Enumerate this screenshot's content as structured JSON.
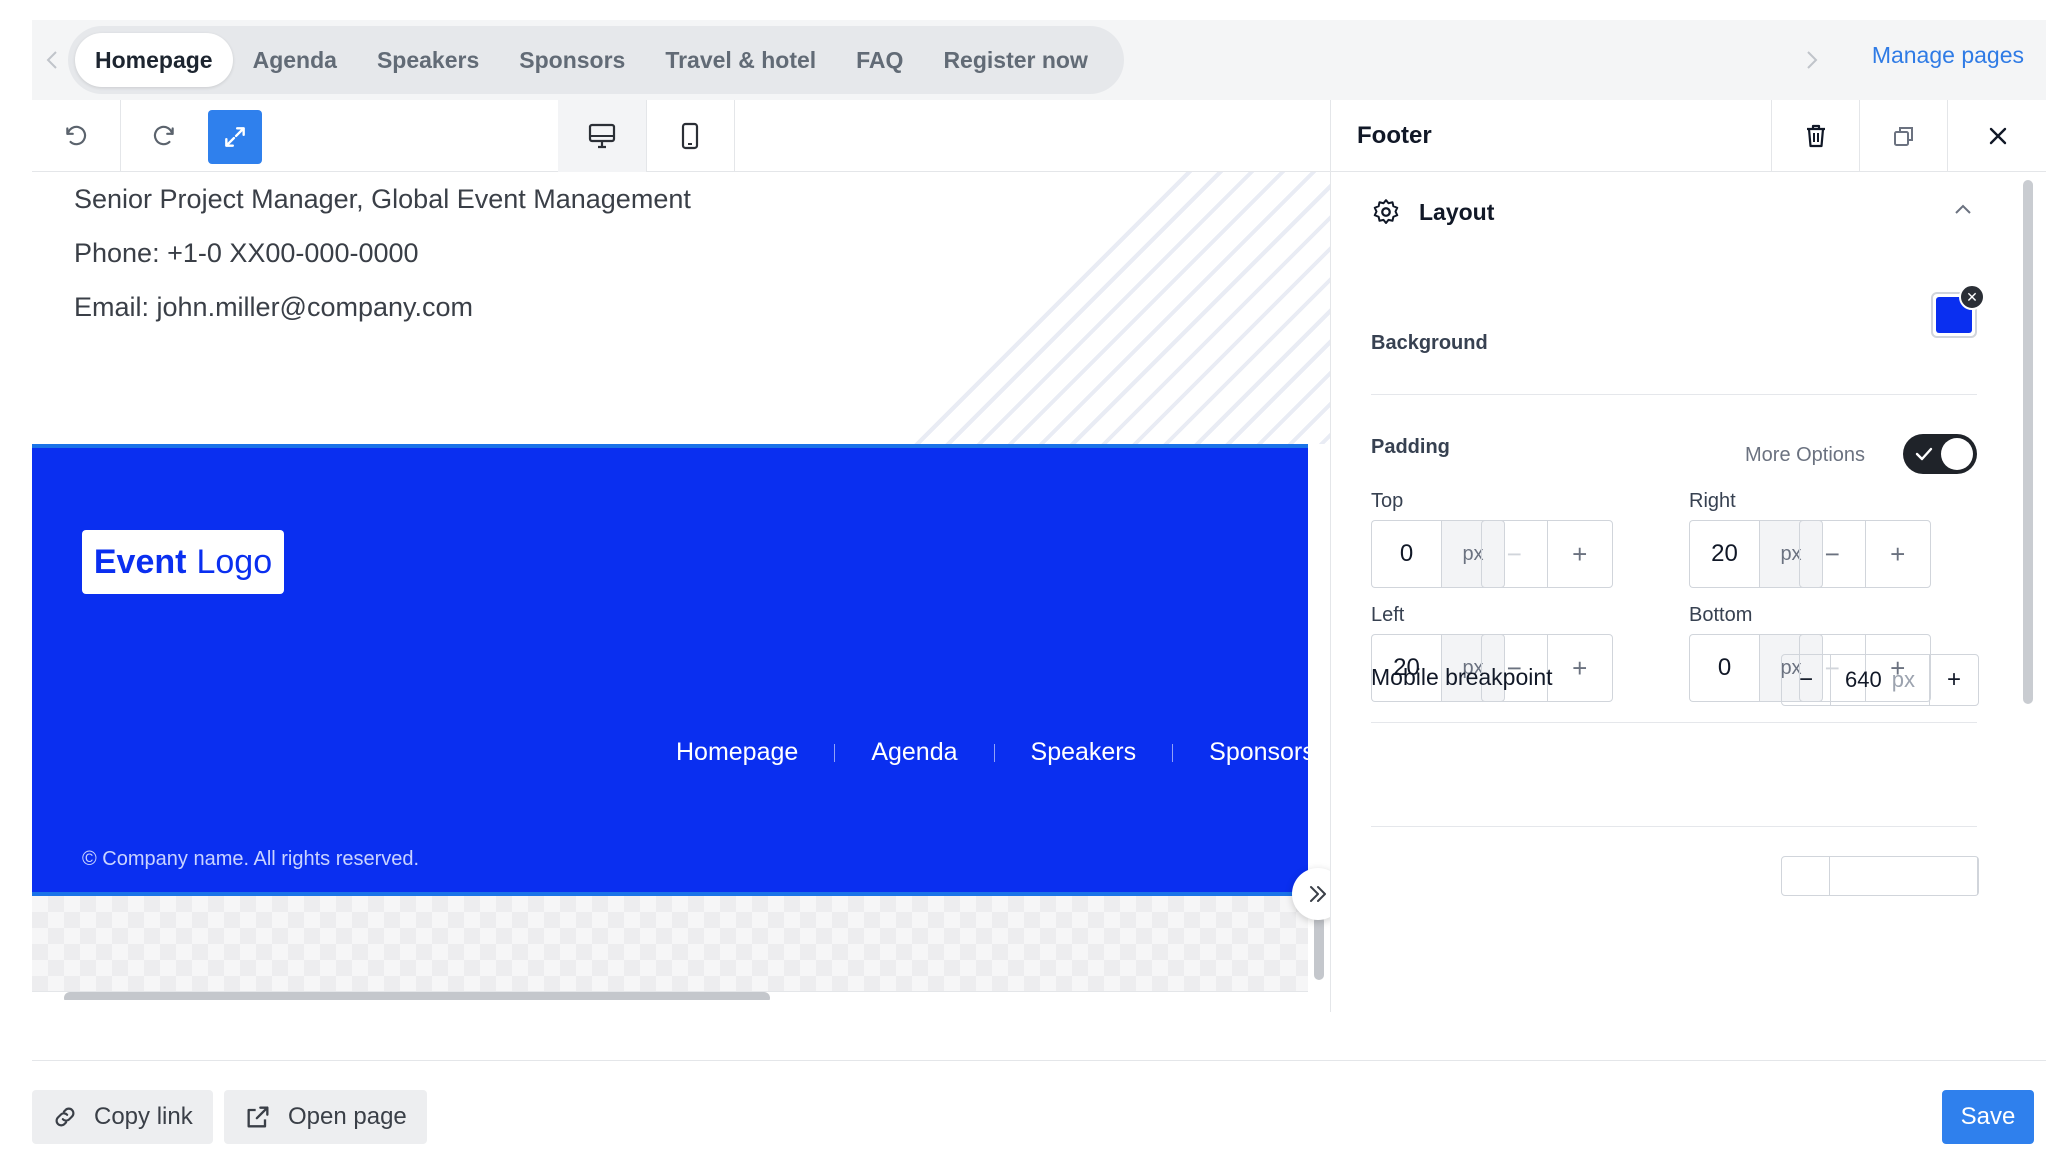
{
  "tabs": {
    "items": [
      {
        "label": "Homepage",
        "active": true
      },
      {
        "label": "Agenda",
        "active": false
      },
      {
        "label": "Speakers",
        "active": false
      },
      {
        "label": "Sponsors",
        "active": false
      },
      {
        "label": "Travel & hotel",
        "active": false
      },
      {
        "label": "FAQ",
        "active": false
      },
      {
        "label": "Register now",
        "active": false
      }
    ],
    "manage_pages_label": "Manage pages"
  },
  "toolbar": {
    "icons": [
      "undo-icon",
      "redo-icon",
      "expand-icon",
      "desktop-icon",
      "mobile-icon"
    ],
    "active_device": "desktop"
  },
  "canvas": {
    "contact": {
      "title_line": "Senior Project Manager, Global Event Management",
      "phone_line": "Phone: +1-0 XX00-000-0000",
      "email_line": "Email: john.miller@company.com"
    },
    "footer": {
      "logo_bold": "Event",
      "logo_regular": "Logo",
      "nav": [
        "Homepage",
        "Agenda",
        "Speakers",
        "Sponsors"
      ],
      "copyright": "© Company name. All rights reserved.",
      "background_color": "#0a2ff0"
    }
  },
  "panel": {
    "title": "Footer",
    "section_title": "Layout",
    "background_label": "Background",
    "background_color": "#0a2ff0",
    "padding_label": "Padding",
    "more_options_label": "More Options",
    "more_options_enabled": true,
    "padding": {
      "top": {
        "label": "Top",
        "value": "0",
        "unit": "px"
      },
      "right": {
        "label": "Right",
        "value": "20",
        "unit": "px"
      },
      "left": {
        "label": "Left",
        "value": "20",
        "unit": "px"
      },
      "bottom": {
        "label": "Bottom",
        "value": "0",
        "unit": "px"
      }
    },
    "mobile_breakpoint": {
      "label": "Mobile breakpoint",
      "value": "640",
      "unit": "px"
    },
    "stepper": {
      "minus": "−",
      "plus": "+"
    }
  },
  "bottom_bar": {
    "copy_link_label": "Copy link",
    "open_page_label": "Open page",
    "save_label": "Save"
  },
  "colors": {
    "accent": "#2f80ed",
    "footer_blue": "#0a2ff0"
  }
}
